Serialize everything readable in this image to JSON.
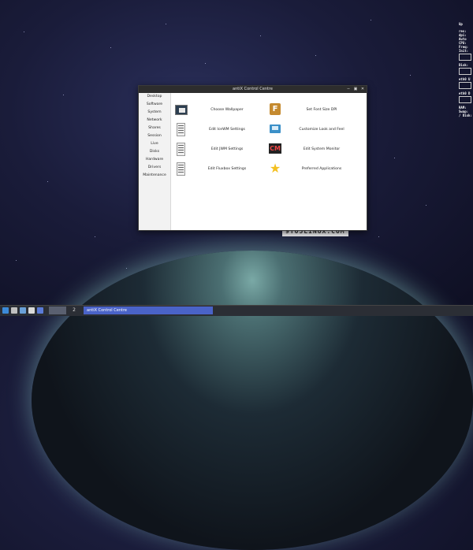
{
  "window": {
    "title": "antiX Control Centre"
  },
  "sidebar": {
    "items": [
      {
        "label": "Desktop"
      },
      {
        "label": "Software"
      },
      {
        "label": "System"
      },
      {
        "label": "Network"
      },
      {
        "label": "Shares"
      },
      {
        "label": "Session"
      },
      {
        "label": "Live"
      },
      {
        "label": "Disks"
      },
      {
        "label": "Hardware"
      },
      {
        "label": "Drivers"
      },
      {
        "label": "Maintenance"
      }
    ]
  },
  "content": {
    "left": [
      {
        "label": "Choose Wallpaper",
        "icon": "wallpaper-icon"
      },
      {
        "label": "Edit IceWM Settings",
        "icon": "document-icon"
      },
      {
        "label": "Edit JWM Settings",
        "icon": "document-icon"
      },
      {
        "label": "Edit Fluxbox Settings",
        "icon": "document-icon"
      }
    ],
    "right": [
      {
        "label": "Set Font Size DPI",
        "icon": "font-icon"
      },
      {
        "label": "Customize Look and Feel",
        "icon": "look-feel-icon"
      },
      {
        "label": "Edit System Monitor",
        "icon": "system-monitor-icon"
      },
      {
        "label": "Preferred Applications",
        "icon": "star-icon"
      }
    ]
  },
  "conky": {
    "lines": [
      "Up",
      "res:",
      "dpi:",
      "Auto",
      "CPU:",
      "Freq:",
      "Init:",
      "Disk:",
      "eth0 U",
      "eth0 D",
      "RAM:",
      "Swap:",
      "/ Disk:"
    ]
  },
  "watermark": "9TO5LINUX.COM",
  "taskbar": {
    "workspace_2": "2",
    "task_label": "antiX Control Centre"
  },
  "colors": {
    "task_button": "#4a63c8",
    "titlebar": "#2d2d2d",
    "font_icon": "#c58a2f",
    "star_icon": "#f4c020"
  }
}
